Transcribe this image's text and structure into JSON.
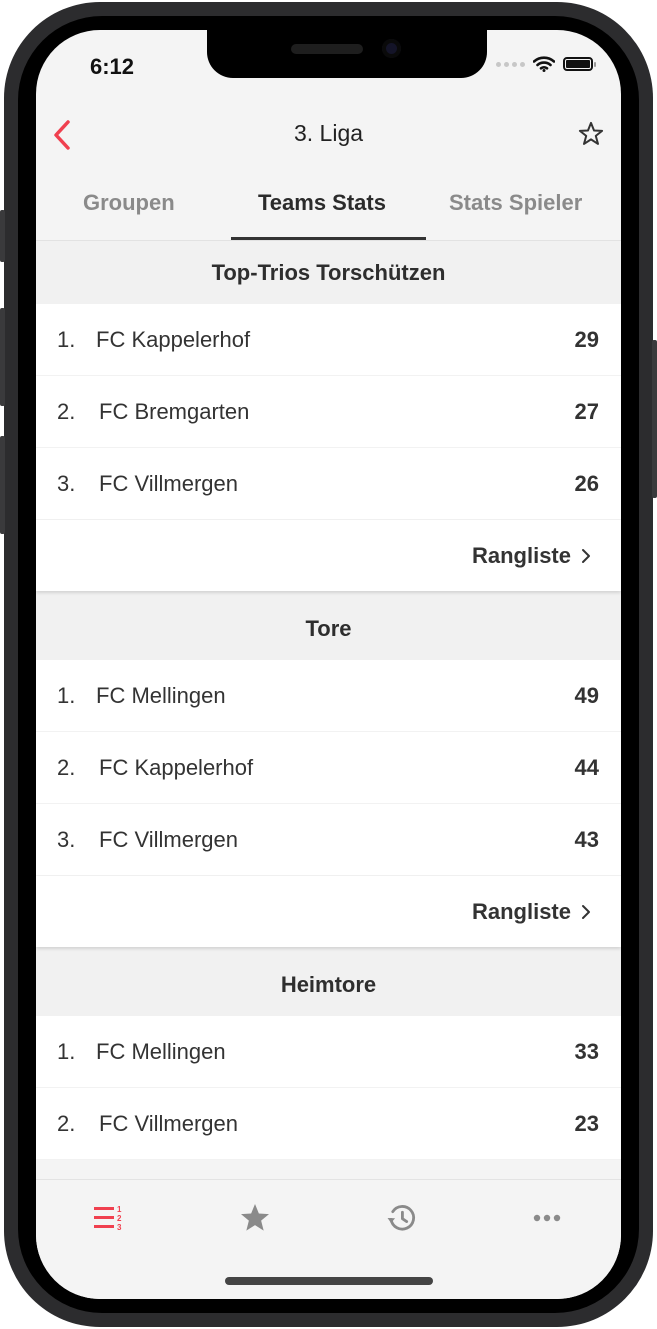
{
  "status_bar": {
    "time": "6:12"
  },
  "navbar": {
    "title": "3. Liga",
    "back_icon": "chevron-left-icon",
    "favorite_icon": "star-outline-icon"
  },
  "tabs": [
    {
      "label": "Groupen",
      "active": false
    },
    {
      "label": "Teams Stats",
      "active": true
    },
    {
      "label": "Stats Spieler",
      "active": false
    }
  ],
  "sections": [
    {
      "title": "Top-Trios Torschützen",
      "rows": [
        {
          "rank": "1.",
          "team": "FC Kappelerhof",
          "value": "29"
        },
        {
          "rank": "2.",
          "team": "FC Bremgarten",
          "value": "27"
        },
        {
          "rank": "3.",
          "team": "FC Villmergen",
          "value": "26"
        }
      ],
      "more_label": "Rangliste"
    },
    {
      "title": "Tore",
      "rows": [
        {
          "rank": "1.",
          "team": "FC Mellingen",
          "value": "49"
        },
        {
          "rank": "2.",
          "team": "FC Kappelerhof",
          "value": "44"
        },
        {
          "rank": "3.",
          "team": "FC Villmergen",
          "value": "43"
        }
      ],
      "more_label": "Rangliste"
    },
    {
      "title": "Heimtore",
      "rows": [
        {
          "rank": "1.",
          "team": "FC Mellingen",
          "value": "33"
        },
        {
          "rank": "2.",
          "team": "FC Villmergen",
          "value": "23"
        }
      ]
    }
  ],
  "tabbar": [
    {
      "icon": "ranking-list-icon",
      "active": true
    },
    {
      "icon": "star-icon",
      "active": false
    },
    {
      "icon": "history-icon",
      "active": false
    },
    {
      "icon": "more-icon",
      "active": false
    }
  ],
  "colors": {
    "accent": "#f0404f",
    "inactive_icon": "#8a8a8a",
    "text": "#333333"
  }
}
